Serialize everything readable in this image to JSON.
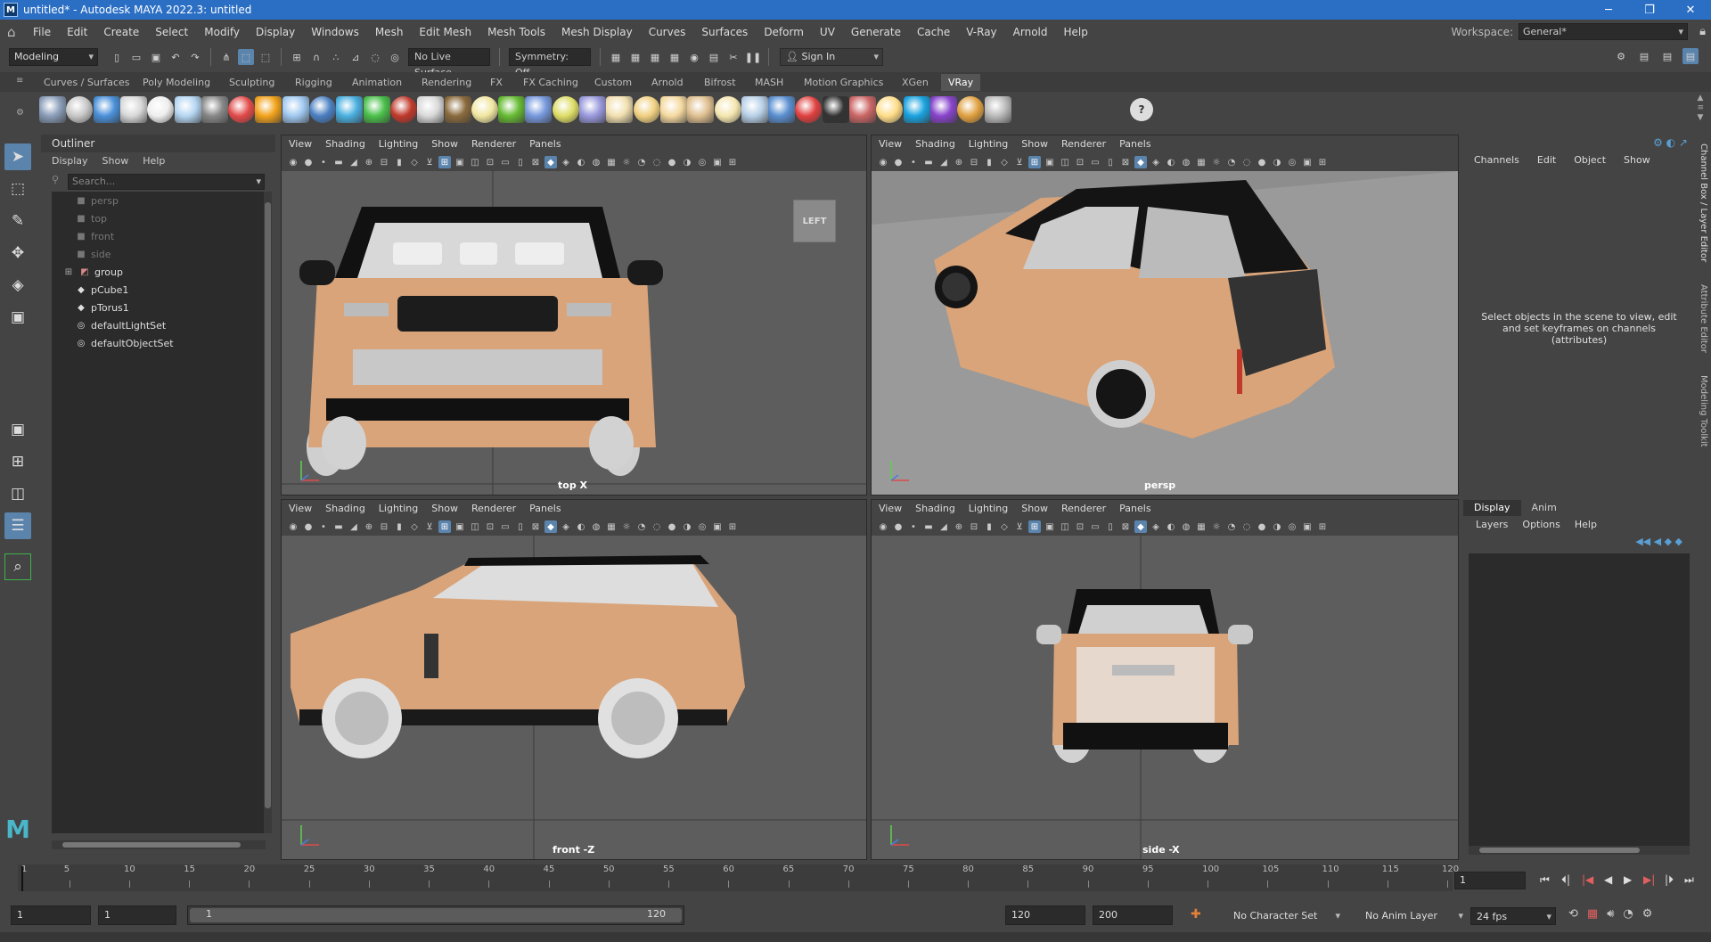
{
  "window": {
    "title": "untitled* - Autodesk MAYA 2022.3: untitled"
  },
  "menubar": {
    "items": [
      "File",
      "Edit",
      "Create",
      "Select",
      "Modify",
      "Display",
      "Windows",
      "Mesh",
      "Edit Mesh",
      "Mesh Tools",
      "Mesh Display",
      "Curves",
      "Surfaces",
      "Deform",
      "UV",
      "Generate",
      "Cache",
      "V-Ray",
      "Arnold",
      "Help"
    ],
    "workspace_label": "Workspace:",
    "workspace_value": "General*"
  },
  "statusline": {
    "mode": "Modeling",
    "live_surface": "No Live Surface",
    "symmetry": "Symmetry: Off",
    "sign_in": "Sign In"
  },
  "shelf": {
    "tabs": [
      "Curves / Surfaces",
      "Poly Modeling",
      "Sculpting",
      "Rigging",
      "Animation",
      "Rendering",
      "FX",
      "FX Caching",
      "Custom",
      "Arnold",
      "Bifrost",
      "MASH",
      "Motion Graphics",
      "XGen",
      "VRay"
    ],
    "active_tab": "VRay",
    "icon_colors": [
      "#8a9db8",
      "#c7c7c7",
      "#4a90d9",
      "#d8d8d8",
      "#eeeeee",
      "#b5d6f2",
      "#888",
      "#e24a4a",
      "#f2a31b",
      "#a0c8f0",
      "#4a7fc1",
      "#4ab0e0",
      "#4ac04a",
      "#c0392b",
      "#d9d9d9",
      "#8b6b3d",
      "#f0e6a0",
      "#66bb33",
      "#7799dd",
      "#dddd66",
      "#9999dd",
      "#f2e0b0",
      "#f0d080",
      "#f5d9a0",
      "#e0c090",
      "#f5e6b0",
      "#b8d0e8",
      "#5a8fd0",
      "#e04040",
      "#333333",
      "#cc6666",
      "#ffdd88",
      "#1aa3e0",
      "#8844cc",
      "#e0a040",
      "#bbbbbb"
    ]
  },
  "outliner": {
    "title": "Outliner",
    "menu": [
      "Display",
      "Show",
      "Help"
    ],
    "search_placeholder": "Search...",
    "items": [
      {
        "label": "persp",
        "icon": "camera-icon",
        "dim": true
      },
      {
        "label": "top",
        "icon": "camera-icon",
        "dim": true
      },
      {
        "label": "front",
        "icon": "camera-icon",
        "dim": true
      },
      {
        "label": "side",
        "icon": "camera-icon",
        "dim": true
      },
      {
        "label": "group",
        "icon": "group-icon",
        "dim": false,
        "expandable": true
      },
      {
        "label": "pCube1",
        "icon": "mesh-icon",
        "dim": false
      },
      {
        "label": "pTorus1",
        "icon": "mesh-icon",
        "dim": false
      },
      {
        "label": "defaultLightSet",
        "icon": "set-icon",
        "dim": false
      },
      {
        "label": "defaultObjectSet",
        "icon": "set-icon",
        "dim": false
      }
    ]
  },
  "viewports": [
    {
      "menu": [
        "View",
        "Shading",
        "Lighting",
        "Show",
        "Renderer",
        "Panels"
      ],
      "camera": "top X",
      "cube_label": "LEFT"
    },
    {
      "menu": [
        "View",
        "Shading",
        "Lighting",
        "Show",
        "Renderer",
        "Panels"
      ],
      "camera": "persp"
    },
    {
      "menu": [
        "View",
        "Shading",
        "Lighting",
        "Show",
        "Renderer",
        "Panels"
      ],
      "camera": "front -Z"
    },
    {
      "menu": [
        "View",
        "Shading",
        "Lighting",
        "Show",
        "Renderer",
        "Panels"
      ],
      "camera": "side -X"
    }
  ],
  "channelbox": {
    "menu": [
      "Channels",
      "Edit",
      "Object",
      "Show"
    ],
    "hint": "Select objects in the scene to view, edit and set keyframes on channels (attributes)"
  },
  "layer_editor": {
    "tabs": [
      "Display",
      "Anim"
    ],
    "menu": [
      "Layers",
      "Options",
      "Help"
    ]
  },
  "side_tabs": [
    "Channel Box / Layer Editor",
    "Attribute Editor",
    "Modeling Toolkit"
  ],
  "timeslider": {
    "ticks": [
      "5",
      "10",
      "15",
      "20",
      "25",
      "30",
      "35",
      "40",
      "45",
      "50",
      "55",
      "60",
      "65",
      "70",
      "75",
      "80",
      "85",
      "90",
      "95",
      "100",
      "105",
      "110",
      "115",
      "120"
    ],
    "start_label": "1",
    "current_frame": "1"
  },
  "rangeslider": {
    "start": "1",
    "playback_start": "1",
    "range_start": "1",
    "range_end": "120",
    "playback_end": "120",
    "end": "200",
    "character_set": "No Character Set",
    "anim_layer": "No Anim Layer",
    "fps": "24 fps"
  }
}
